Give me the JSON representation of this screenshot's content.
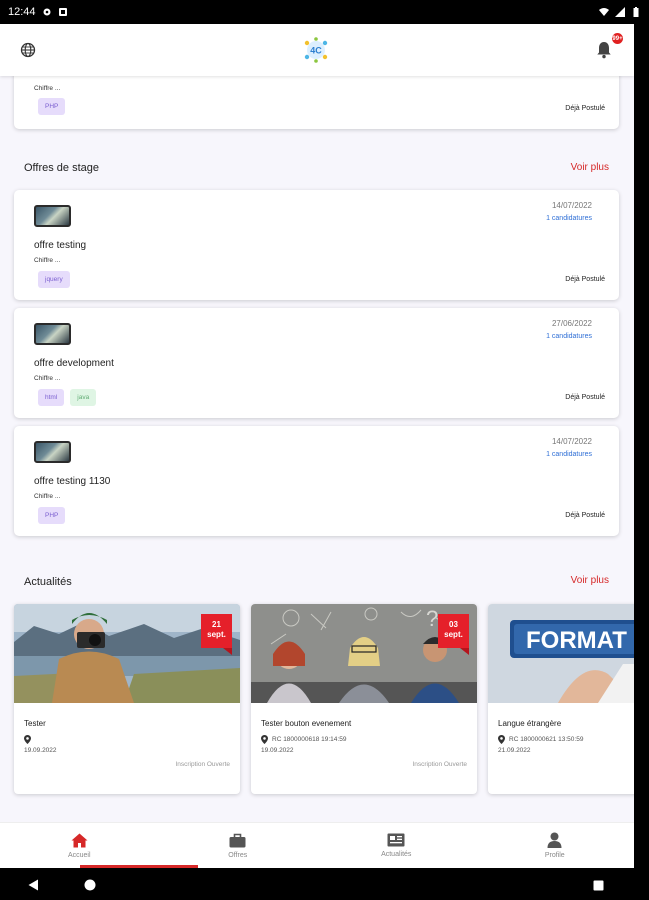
{
  "statusbar": {
    "time": "12:44"
  },
  "appbar": {
    "notification_count": "99+"
  },
  "top_partial_card": {
    "sub": "Chiffre ...",
    "tag": "PHP",
    "status": "Déjà Postulé"
  },
  "offres_section": {
    "title": "Offres de stage",
    "voir_plus": "Voir plus"
  },
  "offers": [
    {
      "date": "14/07/2022",
      "candidatures": "1 candidatures",
      "title": "offre testing",
      "sub": "Chiffre ...",
      "tags": [
        {
          "label": "jquery",
          "color": "purple"
        }
      ],
      "status": "Déjà Postulé"
    },
    {
      "date": "27/06/2022",
      "candidatures": "1 candidatures",
      "title": "offre development",
      "sub": "Chiffre ...",
      "tags": [
        {
          "label": "html",
          "color": "purple"
        },
        {
          "label": "java",
          "color": "green"
        }
      ],
      "status": "Déjà Postulé"
    },
    {
      "date": "14/07/2022",
      "candidatures": "1 candidatures",
      "title": "offre testing 1130",
      "sub": "Chiffre ...",
      "tags": [
        {
          "label": "PHP",
          "color": "purple"
        }
      ],
      "status": "Déjà Postulé"
    }
  ],
  "actualites_section": {
    "title": "Actualités",
    "voir_plus": "Voir plus"
  },
  "news": [
    {
      "badge_day": "21",
      "badge_month": "sept.",
      "title": "Tester",
      "location": "",
      "date": "19.09.2022",
      "meta": "Inscription Ouverte"
    },
    {
      "badge_day": "03",
      "badge_month": "sept.",
      "title": "Tester bouton evenement",
      "location": "RC 1800000618 19:14:59",
      "date": "19.09.2022",
      "meta": "Inscription Ouverte"
    },
    {
      "title": "Langue étrangère",
      "location": "RC 1800000621 13:50:59",
      "date": "21.09.2022",
      "image_text": "FORMAT"
    }
  ],
  "bottomnav": [
    {
      "label": "Accueil",
      "icon": "home-icon",
      "active": true
    },
    {
      "label": "Offres",
      "icon": "briefcase-icon",
      "active": false
    },
    {
      "label": "Actualités",
      "icon": "newspaper-icon",
      "active": false
    },
    {
      "label": "Profile",
      "icon": "person-icon",
      "active": false
    }
  ],
  "colors": {
    "accent": "#d62828",
    "link": "#2f6fd6",
    "tag_purple": "#e6dcfb",
    "tag_green": "#dff5e4"
  }
}
